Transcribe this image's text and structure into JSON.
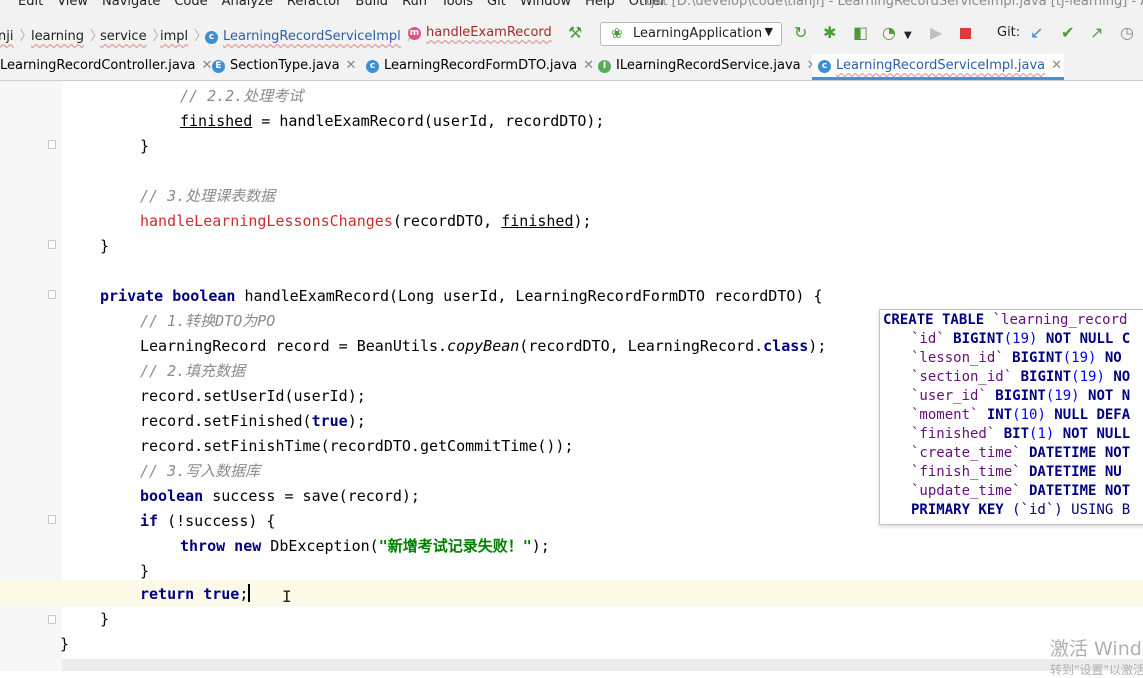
{
  "menubar": {
    "items": [
      "Edit",
      "View",
      "Navigate",
      "Code",
      "Analyze",
      "Refactor",
      "Build",
      "Run",
      "Tools",
      "Git",
      "Window",
      "Help",
      "Other"
    ],
    "window_title": "tjxt [D:\\develop\\code\\tianji] - LearningRecordServiceImpl.java [tj-learning] - Administ"
  },
  "breadcrumbs": [
    {
      "label": "nji",
      "icon": "none"
    },
    {
      "label": "learning",
      "icon": "none"
    },
    {
      "label": "service",
      "icon": "none"
    },
    {
      "label": "impl",
      "icon": "none"
    },
    {
      "label": "LearningRecordServiceImpl",
      "icon": "class-icon"
    },
    {
      "label": "handleExamRecord",
      "icon": "method-icon"
    }
  ],
  "toolbar": {
    "run_config": "LearningApplication",
    "git_label": "Git:",
    "icons": [
      "build-hammer-icon",
      "rerun-icon",
      "debug-icon",
      "coverage-icon",
      "profile-icon",
      "run-icon",
      "stop-icon",
      "git-update-icon",
      "git-commit-icon",
      "git-push-icon",
      "history-icon"
    ]
  },
  "tabs": [
    {
      "label": "LearningRecordController.java",
      "icon": "class-icon",
      "active": false
    },
    {
      "label": "SectionType.java",
      "icon": "enum-icon",
      "active": false
    },
    {
      "label": "LearningRecordFormDTO.java",
      "icon": "class-icon",
      "active": false
    },
    {
      "label": "ILearningRecordService.java",
      "icon": "interface-icon",
      "active": false
    },
    {
      "label": "LearningRecordServiceImpl.java",
      "icon": "class-icon",
      "active": true
    }
  ],
  "code": {
    "l1": "// 2.2.处理考试",
    "l2a": "finished",
    "l2b": " = handleExamRecord(userId, recordDTO);",
    "l3": "}",
    "l4": "// 3.处理课表数据",
    "l5a": "handleLearningLessonsChanges",
    "l5b": "(recordDTO, ",
    "l5c": "finished",
    "l5d": ");",
    "l6": "}",
    "l7a": "private boolean",
    "l7b": " handleExamRecord(Long userId, LearningRecordFormDTO recordDTO) {",
    "l8": "// 1.转换DTO为PO",
    "l9a": "LearningRecord record = BeanUtils.",
    "l9b": "copyBean",
    "l9c": "(recordDTO, LearningRecord.",
    "l9d": "class",
    "l9e": ");",
    "l10": "// 2.填充数据",
    "l11": "record.setUserId(userId);",
    "l12a": "record.setFinished(",
    "l12b": "true",
    "l12c": ");",
    "l13": "record.setFinishTime(recordDTO.getCommitTime());",
    "l14": "// 3.写入数据库",
    "l15a": "boolean",
    "l15b": " success = save(record);",
    "l16a": "if",
    "l16b": " (!success) {",
    "l17a": "throw new",
    "l17b": " DbException(",
    "l17c": "\"新增考试记录失败！\"",
    "l17d": ");",
    "l18": "}",
    "l19a": "return true",
    "l19b": ";",
    "l20": "}",
    "l21": "}"
  },
  "sql_popup": {
    "r1a": "CREATE TABLE",
    "r1b": " `learning_record",
    "r2a": "`id`",
    "r2b": " BIGINT",
    "r2c": "(19)",
    "r2d": " NOT NULL C",
    "r3a": "`lesson_id`",
    "r3b": " BIGINT",
    "r3c": "(19)",
    "r3d": " NO",
    "r4a": "`section_id`",
    "r4b": " BIGINT",
    "r4c": "(19)",
    "r4d": " NO",
    "r5a": "`user_id`",
    "r5b": " BIGINT",
    "r5c": "(19)",
    "r5d": " NOT N",
    "r6a": "`moment`",
    "r6b": " INT",
    "r6c": "(10)",
    "r6d": " NULL DEFA",
    "r7a": "`finished`",
    "r7b": " BIT",
    "r7c": "(1)",
    "r7d": " NOT NULL",
    "r8a": "`create_time`",
    "r8b": " DATETIME NOT",
    "r9a": "`finish_time`",
    "r9b": " DATETIME NU",
    "r10a": "`update_time`",
    "r10b": " DATETIME NOT",
    "r11a": "PRIMARY KEY",
    "r11b": " (`id`) USING B"
  },
  "watermark": {
    "line1": "激活 Windo",
    "line2": "转到\"设置\"以激活"
  }
}
